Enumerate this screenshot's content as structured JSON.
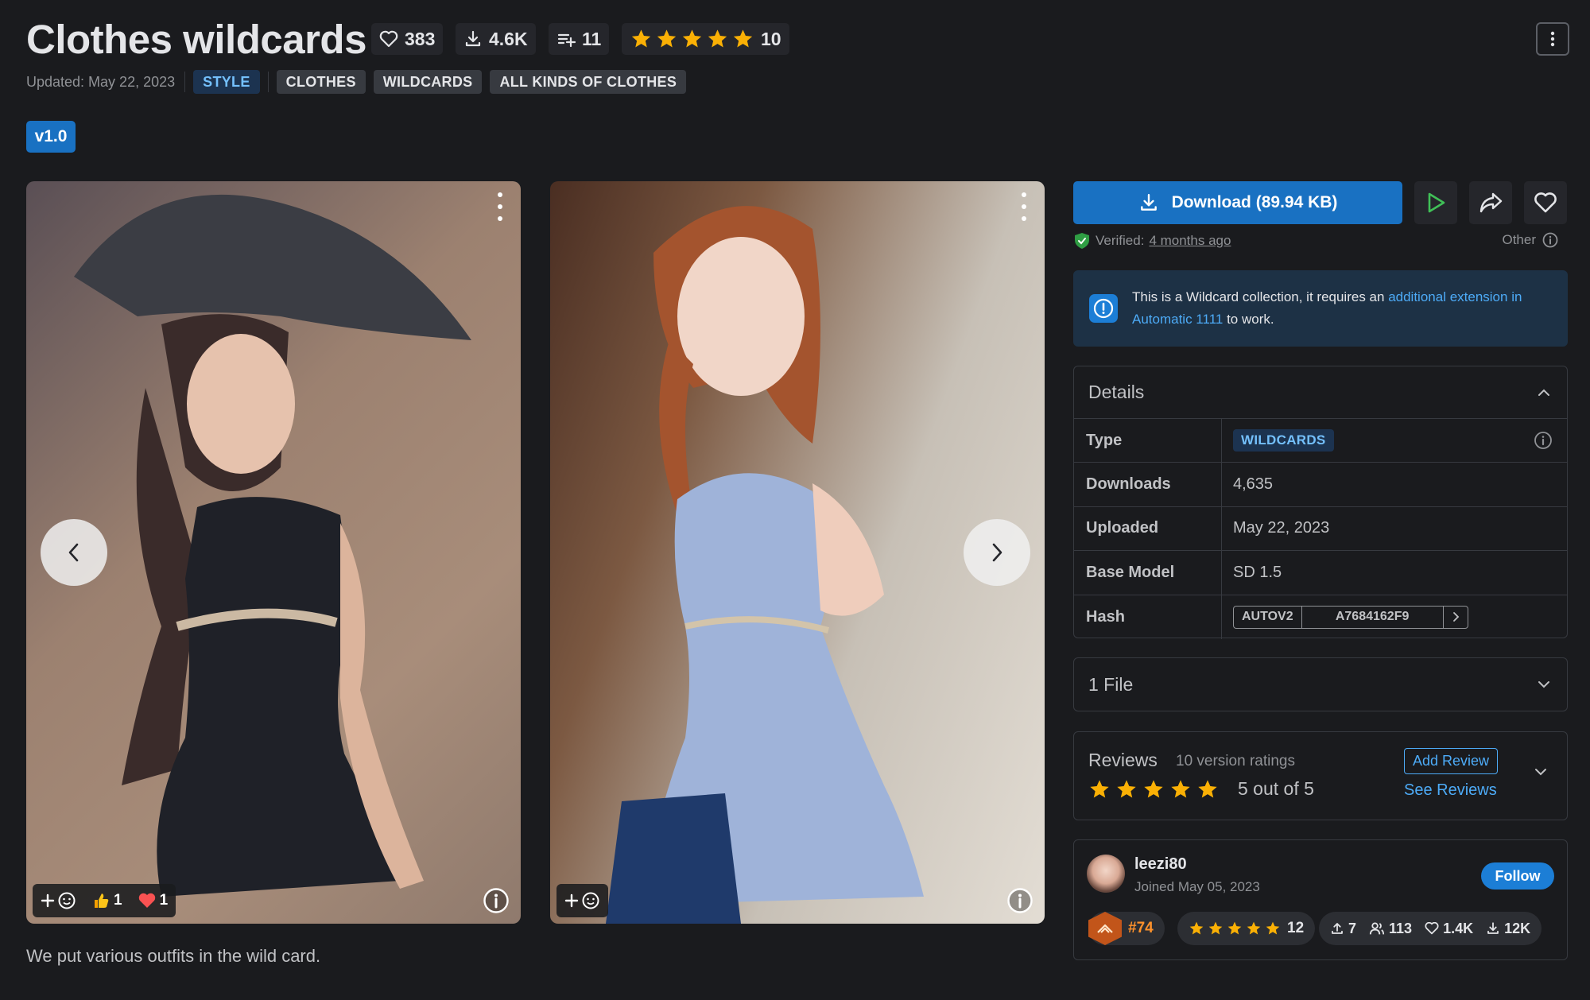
{
  "header": {
    "title": "Clothes wildcards",
    "likes": "383",
    "downloads": "4.6K",
    "collections": "11",
    "rating_count": "10",
    "updated": "Updated: May 22, 2023",
    "tags": [
      "STYLE",
      "CLOTHES",
      "WILDCARDS",
      "ALL KINDS OF CLOTHES"
    ],
    "version": "v1.0"
  },
  "gallery": {
    "image1": {
      "reactions": {
        "like_count": "1",
        "heart_count": "1"
      }
    },
    "image2": {},
    "description": "We put various outfits in the wild card."
  },
  "sidebar": {
    "download_label": "Download (89.94 KB)",
    "verified_label": "Verified:",
    "verified_time": "4 months ago",
    "other_label": "Other",
    "alert": {
      "text_before": "This is a Wildcard collection, it requires an ",
      "link": "additional extension in Automatic 1111",
      "text_after": " to work."
    },
    "details": {
      "title": "Details",
      "type_label": "Type",
      "type_value": "WILDCARDS",
      "downloads_label": "Downloads",
      "downloads_value": "4,635",
      "uploaded_label": "Uploaded",
      "uploaded_value": "May 22, 2023",
      "base_model_label": "Base Model",
      "base_model_value": "SD 1.5",
      "hash_label": "Hash",
      "hash_type": "AUTOV2",
      "hash_value": "A7684162F9"
    },
    "files_label": "1 File",
    "reviews": {
      "title": "Reviews",
      "count": "10 version ratings",
      "score": "5 out of 5",
      "add_review": "Add Review",
      "see_reviews": "See Reviews"
    },
    "creator": {
      "name": "leezi80",
      "joined": "Joined May 05, 2023",
      "follow": "Follow",
      "rank": "#74",
      "rating_count": "12",
      "uploads": "7",
      "followers": "113",
      "likes": "1.4K",
      "downloads": "12K"
    }
  },
  "colors": {
    "accent": "#1971c2",
    "star": "#fab005",
    "background": "#1a1b1e",
    "panel": "#25262b"
  }
}
